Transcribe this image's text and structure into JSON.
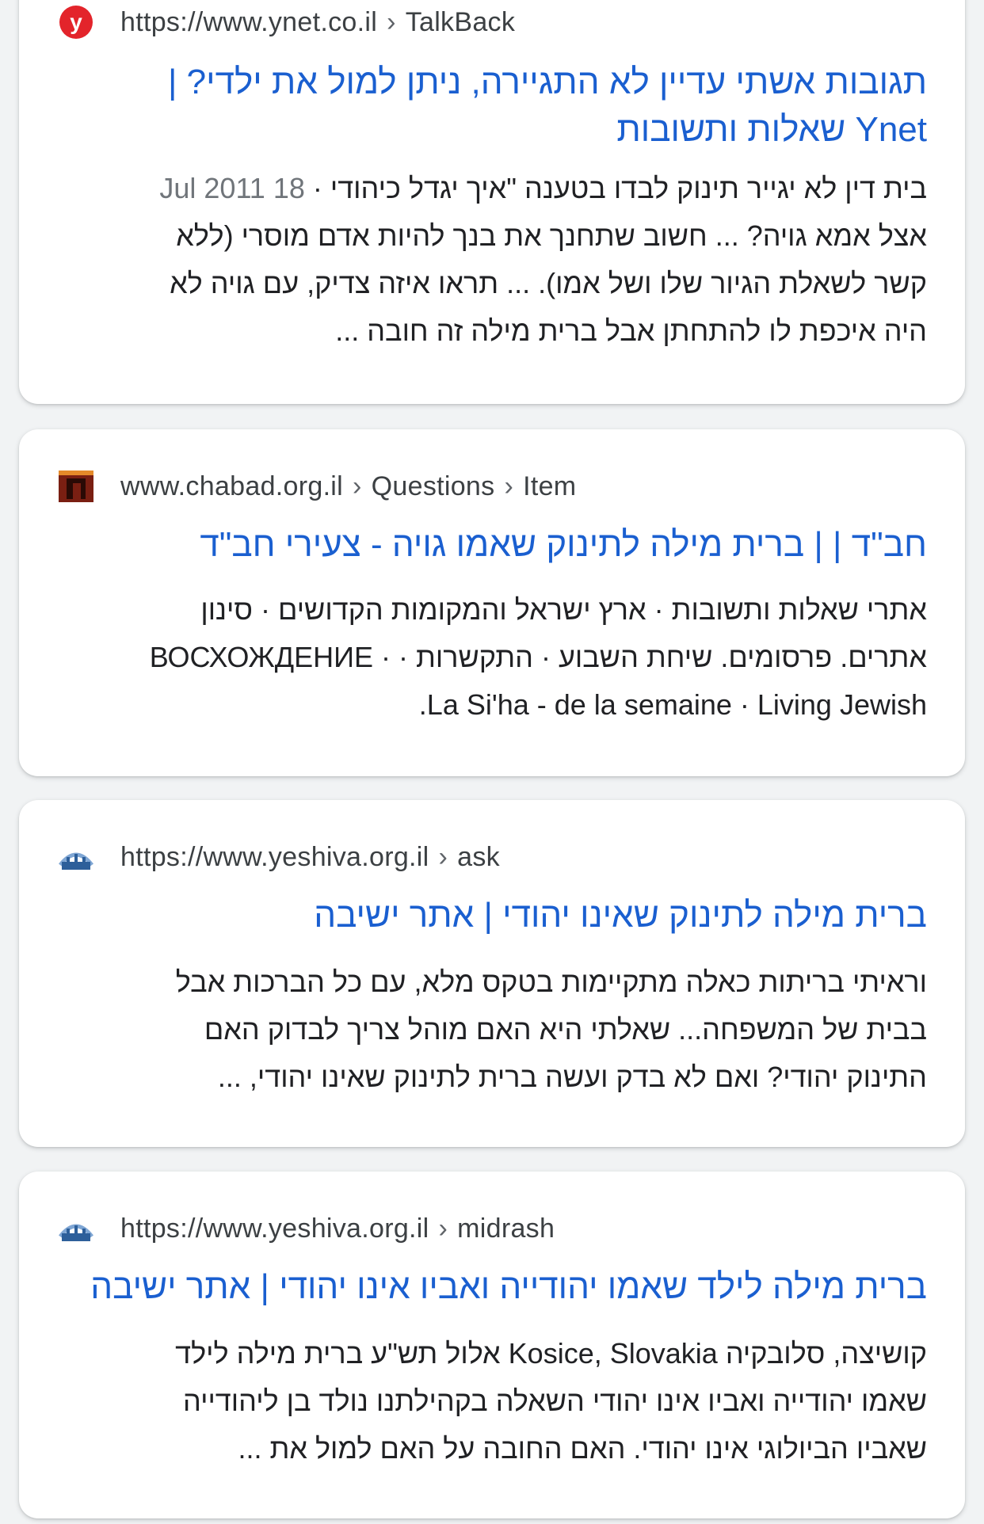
{
  "results": [
    {
      "source": {
        "site": "https://www.ynet.co.il",
        "path": [
          "TalkBack"
        ]
      },
      "favicon": "ynet-logo-icon",
      "title_lines": [
        "תגובות אשתי עדיין לא התגיירה, ניתן למול את ילדי? |",
        "Ynet שאלות ותשובות"
      ],
      "snippet_lines": [
        "בית דין לא יגייר תינוק לבדו בטענה \"איך יגדל כיהודי · ",
        "אצל אמא גויה? ... חשוב שתחנך את בנך להיות אדם מוסרי (ללא",
        "קשר לשאלת הגיור שלו ושל אמו). ... תראו איזה צדיק, עם גויה לא",
        "היה איכפת לו להתחתן אבל ברית מילה זה חובה ..."
      ],
      "date": "18 Jul 2011"
    },
    {
      "source": {
        "site": "www.chabad.org.il",
        "path": [
          "Questions",
          "Item"
        ]
      },
      "favicon": "chabad-logo-icon",
      "title_lines": [
        "חב\"ד | | ברית מילה לתינוק שאמו גויה - צעירי חב\"ד"
      ],
      "snippet_lines": [
        "אתרי שאלות ותשובות · ארץ ישראל והמקומות הקדושים · סינון",
        "אתרים. פרסומים. שיחת השבוע · התקשרות · · ВОСХОЖДЕНИЕ",
        "La Si'ha - de la semaine · Living Jewish."
      ]
    },
    {
      "source": {
        "site": "https://www.yeshiva.org.il",
        "path": [
          "ask"
        ]
      },
      "favicon": "yeshiva-logo-icon",
      "title_lines": [
        "ברית מילה לתינוק שאינו יהודי | אתר ישיבה"
      ],
      "snippet_lines": [
        "וראיתי בריתות כאלה מתקיימות בטקס מלא, עם כל הברכות אבל",
        "בבית של המשפחה... שאלתי היא האם מוהל צריך לבדוק האם",
        "התינוק יהודי? ואם לא בדק ועשה ברית לתינוק שאינו יהודי, ..."
      ]
    },
    {
      "source": {
        "site": "https://www.yeshiva.org.il",
        "path": [
          "midrash"
        ]
      },
      "favicon": "yeshiva-logo-icon",
      "title_lines": [
        "ברית מילה לילד שאמו יהודייה ואביו אינו יהודי | אתר ישיבה"
      ],
      "snippet_lines": [
        "קושיצה, סלובקיה Kosice, Slovakia אלול תש\"ע ברית מילה לילד",
        "שאמו יהודייה ואביו אינו יהודי השאלה בקהילתנו נולד בן ליהודייה",
        "שאביו הביולוגי אינו יהודי. האם החובה על האם למול את ..."
      ]
    }
  ],
  "colors": {
    "title_link": "#1a5fd0",
    "url_text": "#3c4043",
    "snippet_text": "#202124",
    "date_text": "#70757a",
    "ynet_red": "#e3242b",
    "chabad_brown": "#7a1f12",
    "yeshiva_blue": "#2d5f9a"
  }
}
